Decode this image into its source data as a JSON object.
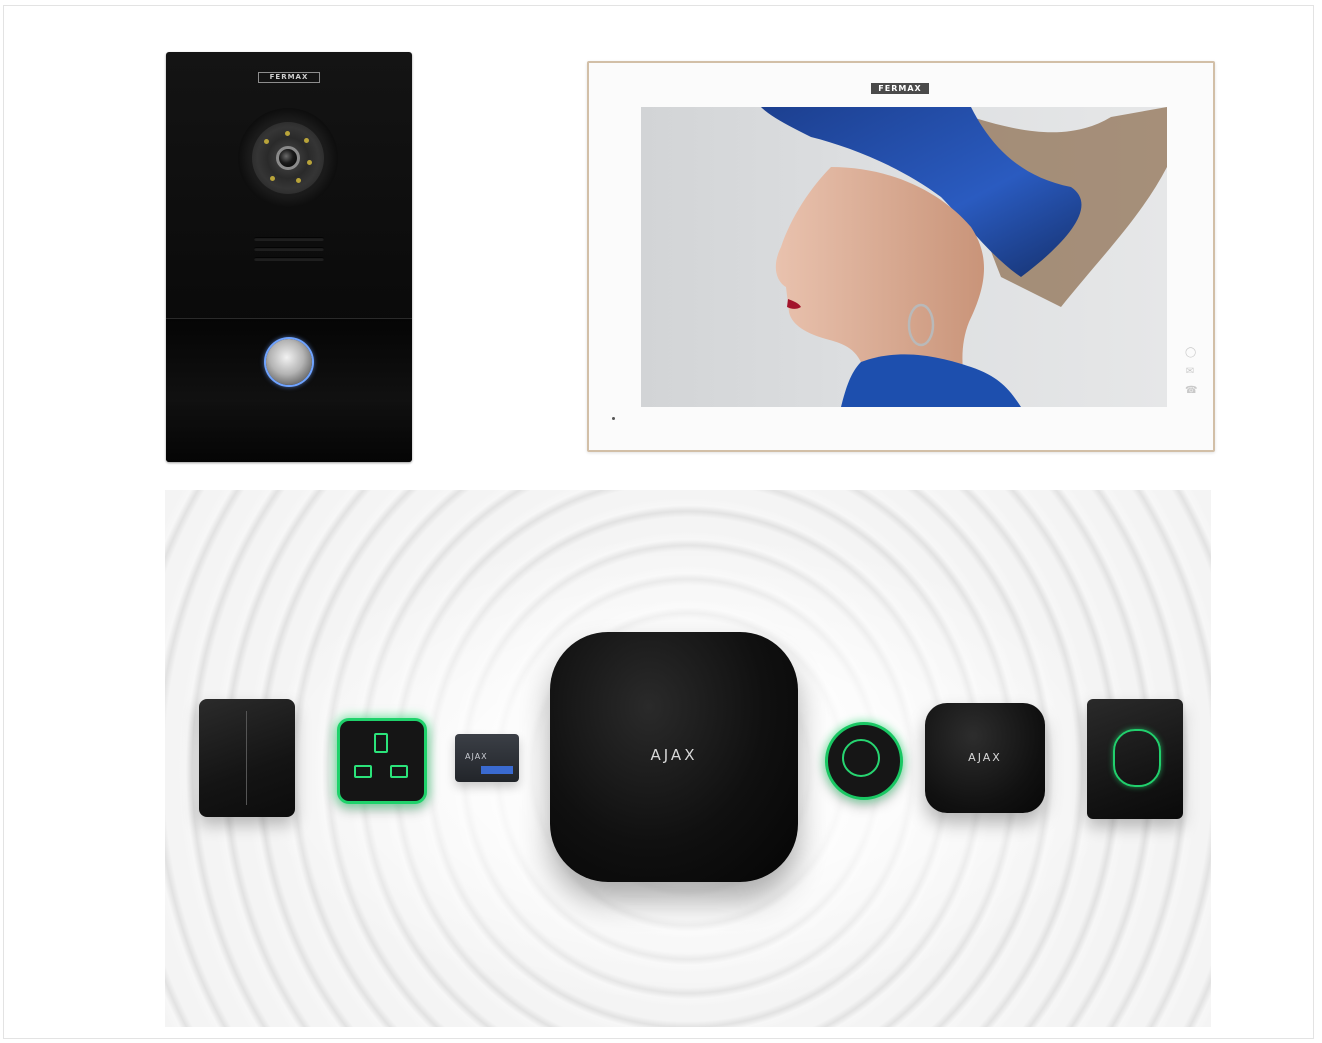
{
  "door_panel": {
    "brand": "FERMAX"
  },
  "monitor": {
    "brand": "FERMAX"
  },
  "ajax": {
    "hub_brand": "AJAX",
    "box_brand": "AJAX",
    "relay_brand": "AJAX"
  },
  "colors": {
    "accent_green": "#1fd26b",
    "button_ring_blue": "#6fa3ff",
    "monitor_frame": "#d2bfa7"
  },
  "icons": [
    "bell-icon",
    "envelope-icon",
    "phone-icon"
  ]
}
